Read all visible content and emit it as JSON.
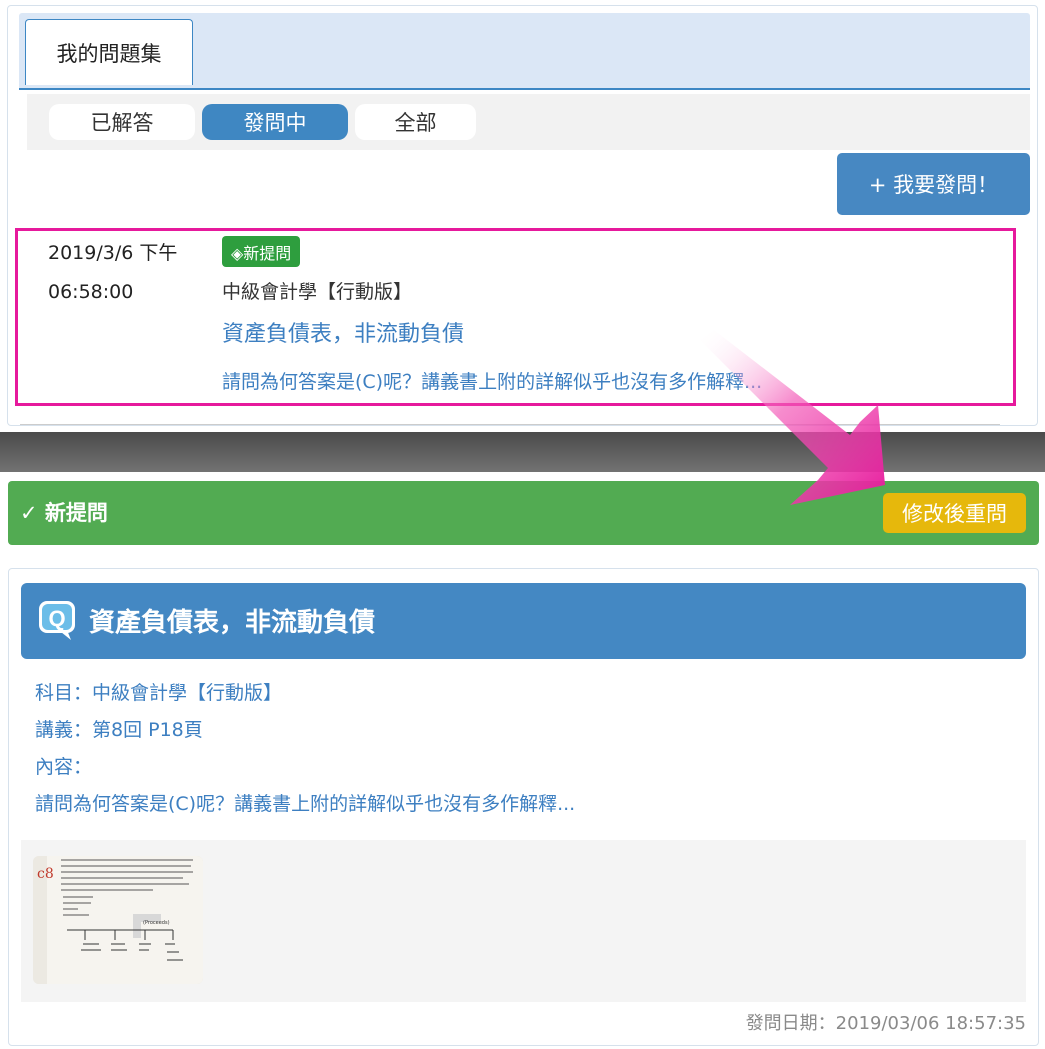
{
  "tabs": {
    "active_label": "我的問題集"
  },
  "filters": [
    {
      "label": "已解答",
      "active": false
    },
    {
      "label": "發問中",
      "active": true
    },
    {
      "label": "全部",
      "active": false
    }
  ],
  "ask_button": {
    "label": "+ 我要發問！"
  },
  "question_item": {
    "date_line1": "2019/3/6 下午",
    "date_line2": "06:58:00",
    "badge": "◈新提問",
    "subject": "中級會計學【行動版】",
    "title": "資產負債表，非流動負債",
    "excerpt": "請問為何答案是(C)呢？講義書上附的詳解似乎也沒有多作解釋..."
  },
  "status_bar": {
    "text": "✓ 新提問",
    "reask_label": "修改後重問",
    "color": "#52ab52"
  },
  "detail": {
    "title": "資產負債表，非流動負債",
    "subject_line": "科目：中級會計學【行動版】",
    "handout_line": "講義：第8回 P18頁",
    "content_label": "內容：",
    "content_text": "請問為何答案是(C)呢？講義書上附的詳解似乎也沒有多作解釋...",
    "post_date": "發問日期：2019/03/06 18:57:35"
  },
  "colors": {
    "primary": "#4488c3",
    "link": "#3d7fc1",
    "highlight": "#e6199c",
    "warning": "#e6b80c"
  }
}
